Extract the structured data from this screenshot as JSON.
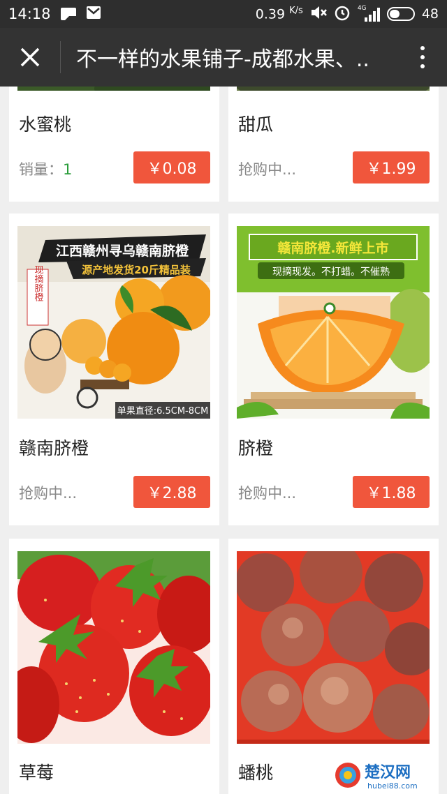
{
  "status_bar": {
    "time": "14:18",
    "speed": "0.39",
    "speed_unit": "K/s",
    "network": "4G",
    "battery": "48"
  },
  "title_bar": {
    "title": "不一样的水果铺子-成都水果、.."
  },
  "products": [
    {
      "name": "水蜜桃",
      "sub_label": "销量：",
      "sub_value": "1",
      "price": "￥0.08"
    },
    {
      "name": "甜瓜",
      "sub_label": "抢购中...",
      "sub_value": "",
      "price": "￥1.99"
    },
    {
      "name": "赣南脐橙",
      "sub_label": "抢购中...",
      "sub_value": "",
      "price": "￥2.88",
      "image_text": {
        "banner": "江西赣州寻乌赣南脐橙",
        "sub_banner": "源产地发货20斤精品装",
        "tag": "现摘脐橙",
        "footer": "单果直径:6.5CM-8CM"
      }
    },
    {
      "name": "脐橙",
      "sub_label": "抢购中...",
      "sub_value": "",
      "price": "￥1.88",
      "image_text": {
        "banner": "赣南脐橙.新鲜上市",
        "sub_banner": "现摘现发。不打蜡。不催熟"
      }
    },
    {
      "name": "草莓"
    },
    {
      "name": "蟠桃"
    }
  ],
  "watermark": {
    "brand": "楚汉网",
    "url": "hubei88.com"
  },
  "colors": {
    "accent": "#f0563c",
    "header": "#333333",
    "status_bar": "#2e2e2e",
    "sales_number": "#2a9d3a"
  }
}
